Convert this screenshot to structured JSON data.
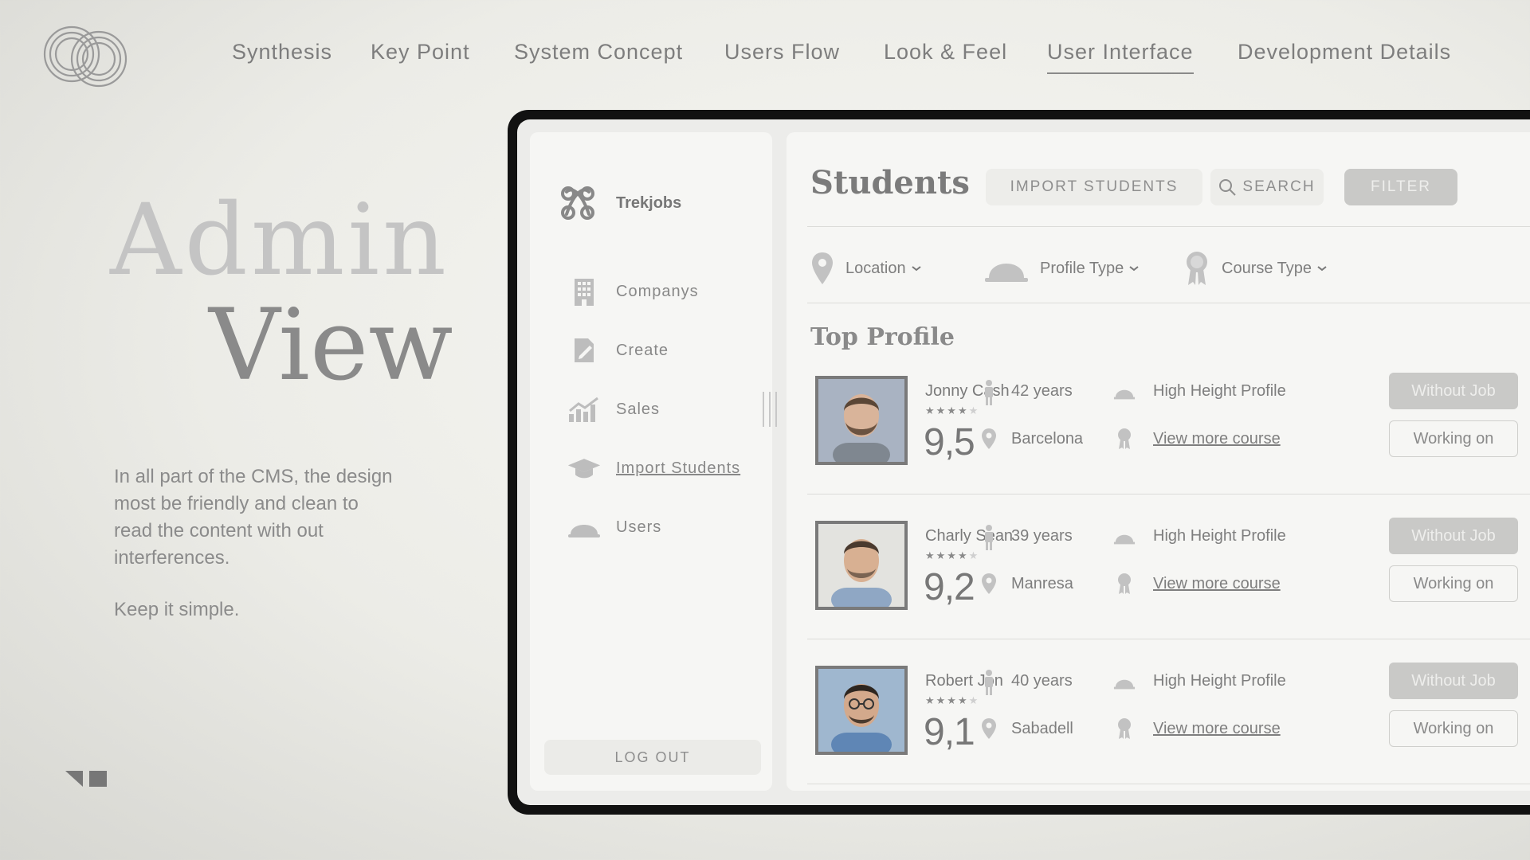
{
  "nav": {
    "items": [
      {
        "label": "Synthesis"
      },
      {
        "label": "Key Point"
      },
      {
        "label": "System Concept"
      },
      {
        "label": "Users Flow"
      },
      {
        "label": "Look & Feel"
      },
      {
        "label": "User Interface",
        "active": true
      },
      {
        "label": "Development Details"
      }
    ]
  },
  "hero": {
    "line1": "Admin",
    "line2": "View",
    "description": "In all part of the CMS, the design most be friendly and clean to read the content with out interferences.",
    "tagline": "Keep it simple."
  },
  "app": {
    "brand": "Trekjobs",
    "menu": [
      {
        "label": "Companys",
        "icon": "building-icon"
      },
      {
        "label": "Create",
        "icon": "edit-document-icon"
      },
      {
        "label": "Sales",
        "icon": "chart-icon"
      },
      {
        "label": "Import Students",
        "icon": "graduation-cap-icon",
        "active": true
      },
      {
        "label": "Users",
        "icon": "helmet-icon"
      }
    ],
    "logout": "LOG OUT"
  },
  "main": {
    "title": "Students",
    "import_button": "IMPORT STUDENTS",
    "search_button": "SEARCH",
    "filter_button": "FILTER",
    "filters": [
      {
        "label": "Location",
        "icon": "location-pin-icon"
      },
      {
        "label": "Profile Type",
        "icon": "helmet-icon"
      },
      {
        "label": "Course Type",
        "icon": "award-ribbon-icon"
      }
    ],
    "section_title": "Top Profile",
    "profiles": [
      {
        "name": "Jonny Cash",
        "stars": 4,
        "max_stars": 5,
        "score": "9,5",
        "age": "42 years",
        "city": "Barcelona",
        "profile": "High Height Profile",
        "course_link": "View more course",
        "btn_status": "Without Job",
        "btn_working": "Working on"
      },
      {
        "name": "Charly Sean",
        "stars": 4,
        "max_stars": 5,
        "score": "9,2",
        "age": "39 years",
        "city": "Manresa",
        "profile": "High Height Profile",
        "course_link": "View more course",
        "btn_status": "Without Job",
        "btn_working": "Working on"
      },
      {
        "name": "Robert Jon",
        "stars": 4,
        "max_stars": 5,
        "score": "9,1",
        "age": "40 years",
        "city": "Sabadell",
        "profile": "High Height Profile",
        "course_link": "View more course",
        "btn_status": "Without Job",
        "btn_working": "Working on"
      }
    ]
  },
  "colors": {
    "background": "#ecece7",
    "device_frame": "#111111",
    "panel": "#f6f6f4",
    "text": "#7a7a7a",
    "filter_button": "#c9c9c7"
  }
}
